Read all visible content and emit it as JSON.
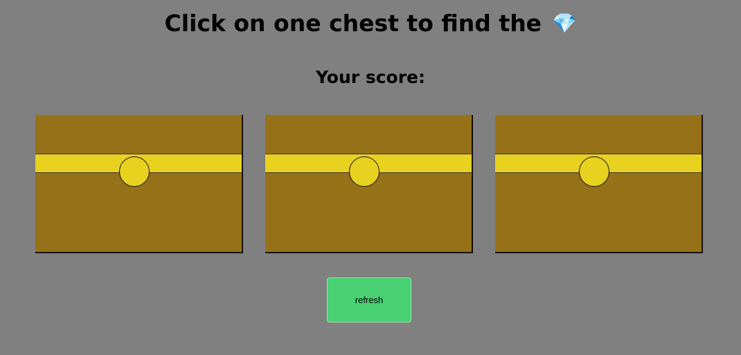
{
  "header": {
    "title": "Click on one chest to find the",
    "title_icon": "💎",
    "title_icon_name": "diamond-icon",
    "score_label": "Your score:"
  },
  "chests": [
    {
      "name": "chest-1"
    },
    {
      "name": "chest-2"
    },
    {
      "name": "chest-3"
    }
  ],
  "controls": {
    "refresh_label": "refresh"
  },
  "colors": {
    "background": "#808080",
    "chest_body": "#977118",
    "chest_band": "#e8d11f",
    "button": "#48d073"
  }
}
